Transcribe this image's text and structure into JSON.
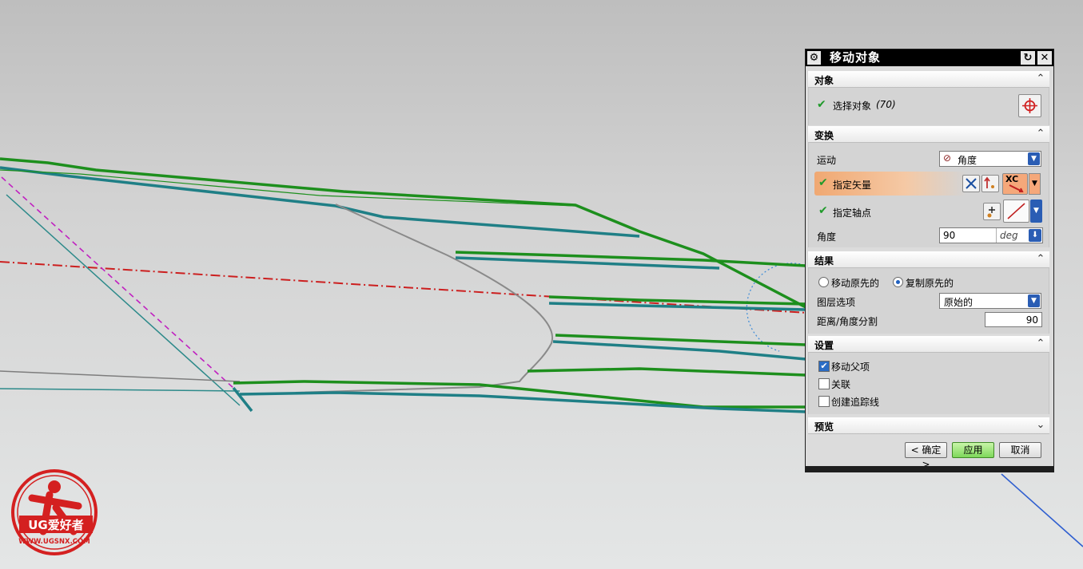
{
  "dialog": {
    "title": "移动对象",
    "sections": {
      "object": {
        "label": "对象",
        "select_label": "选择对象",
        "select_count": "(70)"
      },
      "transform": {
        "label": "变换",
        "motion_label": "运动",
        "motion_value": "角度",
        "vector_label": "指定矢量",
        "vector_option": "XC",
        "pivot_label": "指定轴点",
        "angle_label": "角度",
        "angle_value": "90",
        "angle_unit": "deg"
      },
      "result": {
        "label": "结果",
        "move_original": "移动原先的",
        "copy_original": "复制原先的",
        "layer_label": "图层选项",
        "layer_value": "原始的",
        "divide_label": "距离/角度分割",
        "divide_value": "90"
      },
      "settings": {
        "label": "设置",
        "move_parent": "移动父项",
        "associative": "关联",
        "create_trace": "创建追踪线"
      },
      "preview": {
        "label": "预览"
      }
    },
    "buttons": {
      "ok": "< 确定 >",
      "apply": "应用",
      "cancel": "取消"
    }
  },
  "logo": {
    "text": "UG爱好者",
    "url": "WWW.UGSNX.COM"
  },
  "icons": [
    "gear-icon",
    "reset-icon",
    "close-icon",
    "collapse-icon",
    "crosshair-icon",
    "check-icon",
    "vector-icon",
    "pivot-icon",
    "dropdown-icon"
  ],
  "colors": {
    "green_curve": "#1d8f1d",
    "teal_curve": "#1f8a8a",
    "red_dash": "#cc1f1f",
    "magenta_dash": "#c020c0",
    "title_bar": "#000000",
    "highlight": "#f0a872"
  }
}
